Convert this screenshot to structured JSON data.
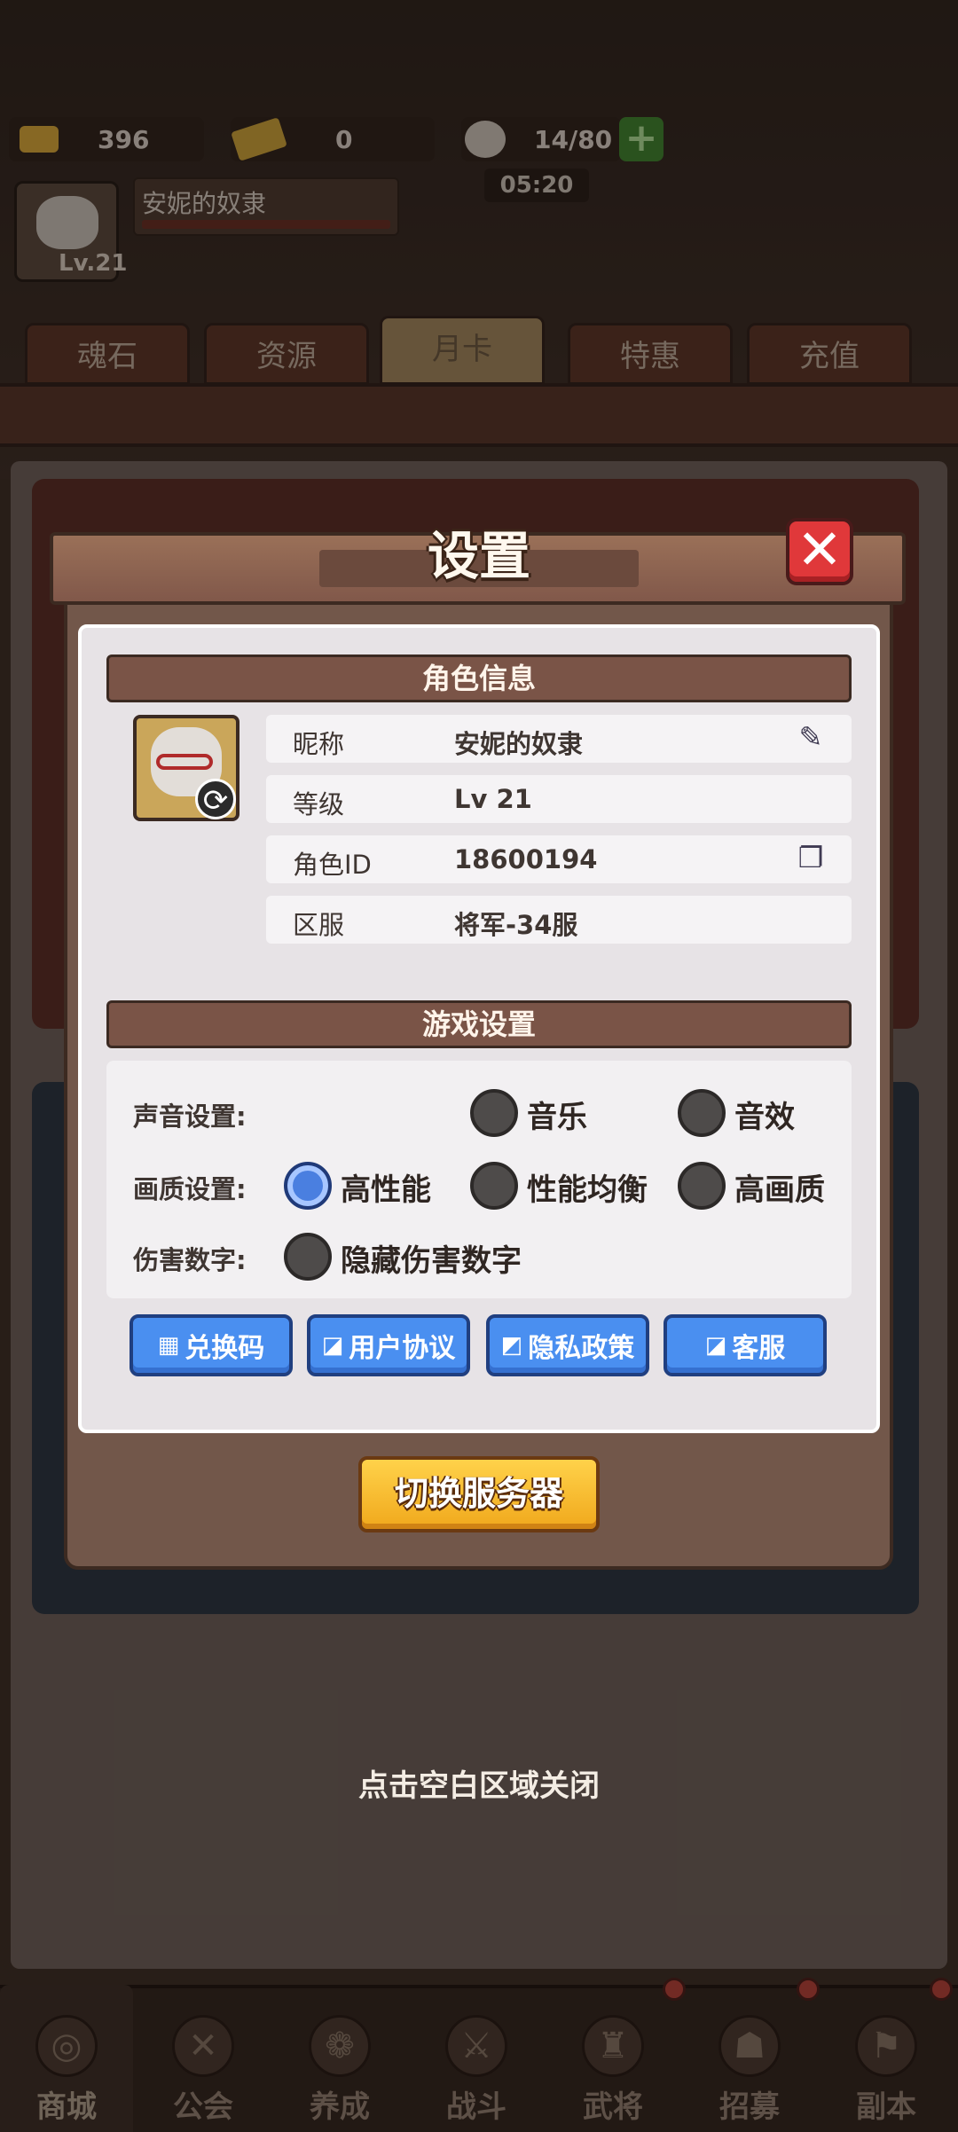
{
  "top_bar": {
    "gold": "396",
    "ticket": "0",
    "stamina": "14/80",
    "plus": "+",
    "timer": "05:20",
    "player_name": "安妮的奴隶",
    "player_level": "Lv.21"
  },
  "shop_tabs": [
    "魂石",
    "资源",
    "月卡",
    "特惠",
    "充值"
  ],
  "modal": {
    "title": "设置",
    "close": "✕",
    "character_section": "角色信息",
    "info": [
      {
        "label": "昵称",
        "value": "安妮的奴隶",
        "icon": "pencil-icon"
      },
      {
        "label": "等级",
        "value": "Lv 21"
      },
      {
        "label": "角色ID",
        "value": "18600194",
        "icon": "copy-icon"
      },
      {
        "label": "区服",
        "value": "将军-34服"
      }
    ],
    "game_section": "游戏设置",
    "settings": {
      "sound_label": "声音设置:",
      "sound_options": [
        "音乐",
        "音效"
      ],
      "quality_label": "画质设置:",
      "quality_options": [
        "高性能",
        "性能均衡",
        "高画质"
      ],
      "quality_selected": "高性能",
      "damage_label": "伤害数字:",
      "damage_option": "隐藏伤害数字"
    },
    "links": [
      "兑换码",
      "用户协议",
      "隐私政策",
      "客服"
    ],
    "switch_server": "切换服务器"
  },
  "tap_to_close": "点击空白区域关闭",
  "bottom_nav": [
    "商城",
    "公会",
    "养成",
    "战斗",
    "武将",
    "招募",
    "副本"
  ],
  "colors": {
    "accent_blue": "#4a8ff0",
    "close_red": "#e0383a",
    "gold_button": "#ffd24a",
    "panel_brown": "#72574a"
  }
}
